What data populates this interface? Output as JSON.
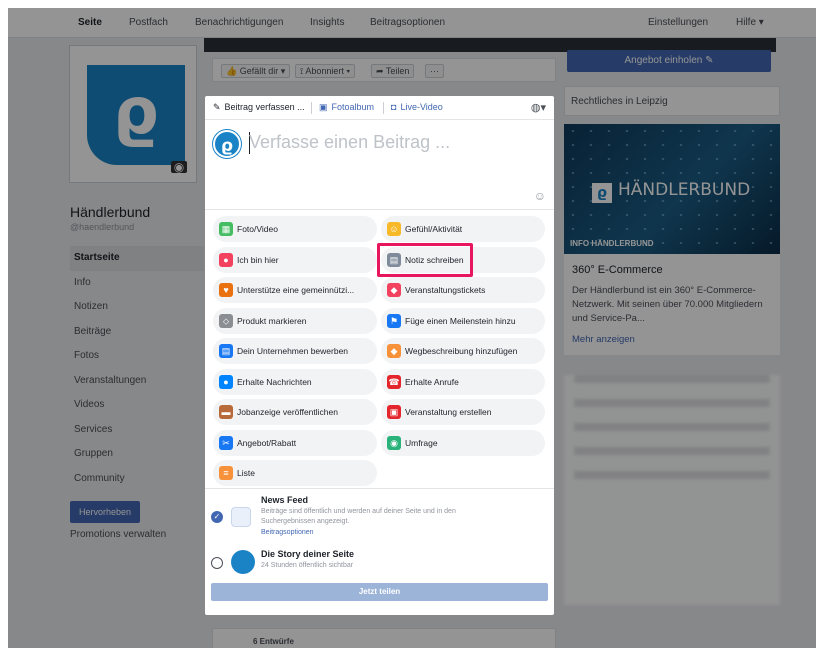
{
  "topbar": {
    "tabs": [
      "Seite",
      "Postfach",
      "Benachrichtigungen",
      "Insights",
      "Beitragsoptionen"
    ],
    "right": [
      "Einstellungen",
      "Hilfe ▾"
    ]
  },
  "page": {
    "name": "Händlerbund",
    "handle": "@haendlerbund",
    "nav": [
      "Startseite",
      "Info",
      "Notizen",
      "Beiträge",
      "Fotos",
      "Veranstaltungen",
      "Videos",
      "Services",
      "Gruppen",
      "Community"
    ],
    "promote_label": "Hervorheben",
    "promotions_label": "Promotions verwalten"
  },
  "action_bar": {
    "like": "Gefällt dir ▾",
    "follow": "Abonniert ▾",
    "share": "Teilen",
    "more": "···"
  },
  "right": {
    "offer_button": "Angebot einholen",
    "local_label": "Rechtliches in Leipzig",
    "banner_brand": "HÄNDLERBUND",
    "banner_info": "INFO HÄNDLERBUND",
    "about_title": "360° E-Commerce",
    "about_text": "Der Händlerbund ist ein 360° E-Commerce-Netzwerk. Mit seinen über 70.000 Mitgliedern und Service-Pa...",
    "about_more": "Mehr anzeigen"
  },
  "bottom_post": "6 Entwürfe",
  "modal": {
    "tabs": [
      "Beitrag verfassen ...",
      "Fotoalbum",
      "Live-Video"
    ],
    "placeholder": "Verfasse einen Beitrag ...",
    "options": [
      {
        "label": "Foto/Video",
        "icon": "photo-icon",
        "color": "#45bd62"
      },
      {
        "label": "Gefühl/Aktivität",
        "icon": "emoji-icon",
        "color": "#f7b928"
      },
      {
        "label": "Ich bin hier",
        "icon": "location-pin-icon",
        "color": "#f3425f"
      },
      {
        "label": "Notiz schreiben",
        "icon": "note-icon",
        "color": "#7f8b9a"
      },
      {
        "label": "Unterstütze eine gemeinnützi...",
        "icon": "heart-icon",
        "color": "#e9710f"
      },
      {
        "label": "Veranstaltungstickets",
        "icon": "ticket-icon",
        "color": "#f3425f"
      },
      {
        "label": "Produkt markieren",
        "icon": "tag-icon",
        "color": "#8a8d91"
      },
      {
        "label": "Füge einen Meilenstein hinzu",
        "icon": "flag-icon",
        "color": "#1877f2"
      },
      {
        "label": "Dein Unternehmen bewerben",
        "icon": "megaphone-icon",
        "color": "#1877f2"
      },
      {
        "label": "Wegbeschreibung hinzufügen",
        "icon": "directions-icon",
        "color": "#f7923a"
      },
      {
        "label": "Erhalte Nachrichten",
        "icon": "messenger-icon",
        "color": "#0084ff"
      },
      {
        "label": "Erhalte Anrufe",
        "icon": "phone-icon",
        "color": "#e4252b"
      },
      {
        "label": "Jobanzeige veröffentlichen",
        "icon": "briefcase-icon",
        "color": "#b96a3a"
      },
      {
        "label": "Veranstaltung erstellen",
        "icon": "calendar-icon",
        "color": "#e4252b"
      },
      {
        "label": "Angebot/Rabatt",
        "icon": "offer-icon",
        "color": "#1877f2"
      },
      {
        "label": "Umfrage",
        "icon": "poll-icon",
        "color": "#2ab27b"
      },
      {
        "label": "Liste",
        "icon": "list-icon",
        "color": "#f7923a"
      }
    ],
    "highlight_color": "#e8175d",
    "news_feed": {
      "title": "News Feed",
      "desc": "Beiträge sind öffentlich und werden auf deiner Seite und in den Suchergebnissen angezeigt.",
      "link": "Beitragsoptionen"
    },
    "story": {
      "title": "Die Story deiner Seite",
      "desc": "24 Stunden öffentlich sichtbar"
    },
    "share_button": "Jetzt teilen"
  }
}
